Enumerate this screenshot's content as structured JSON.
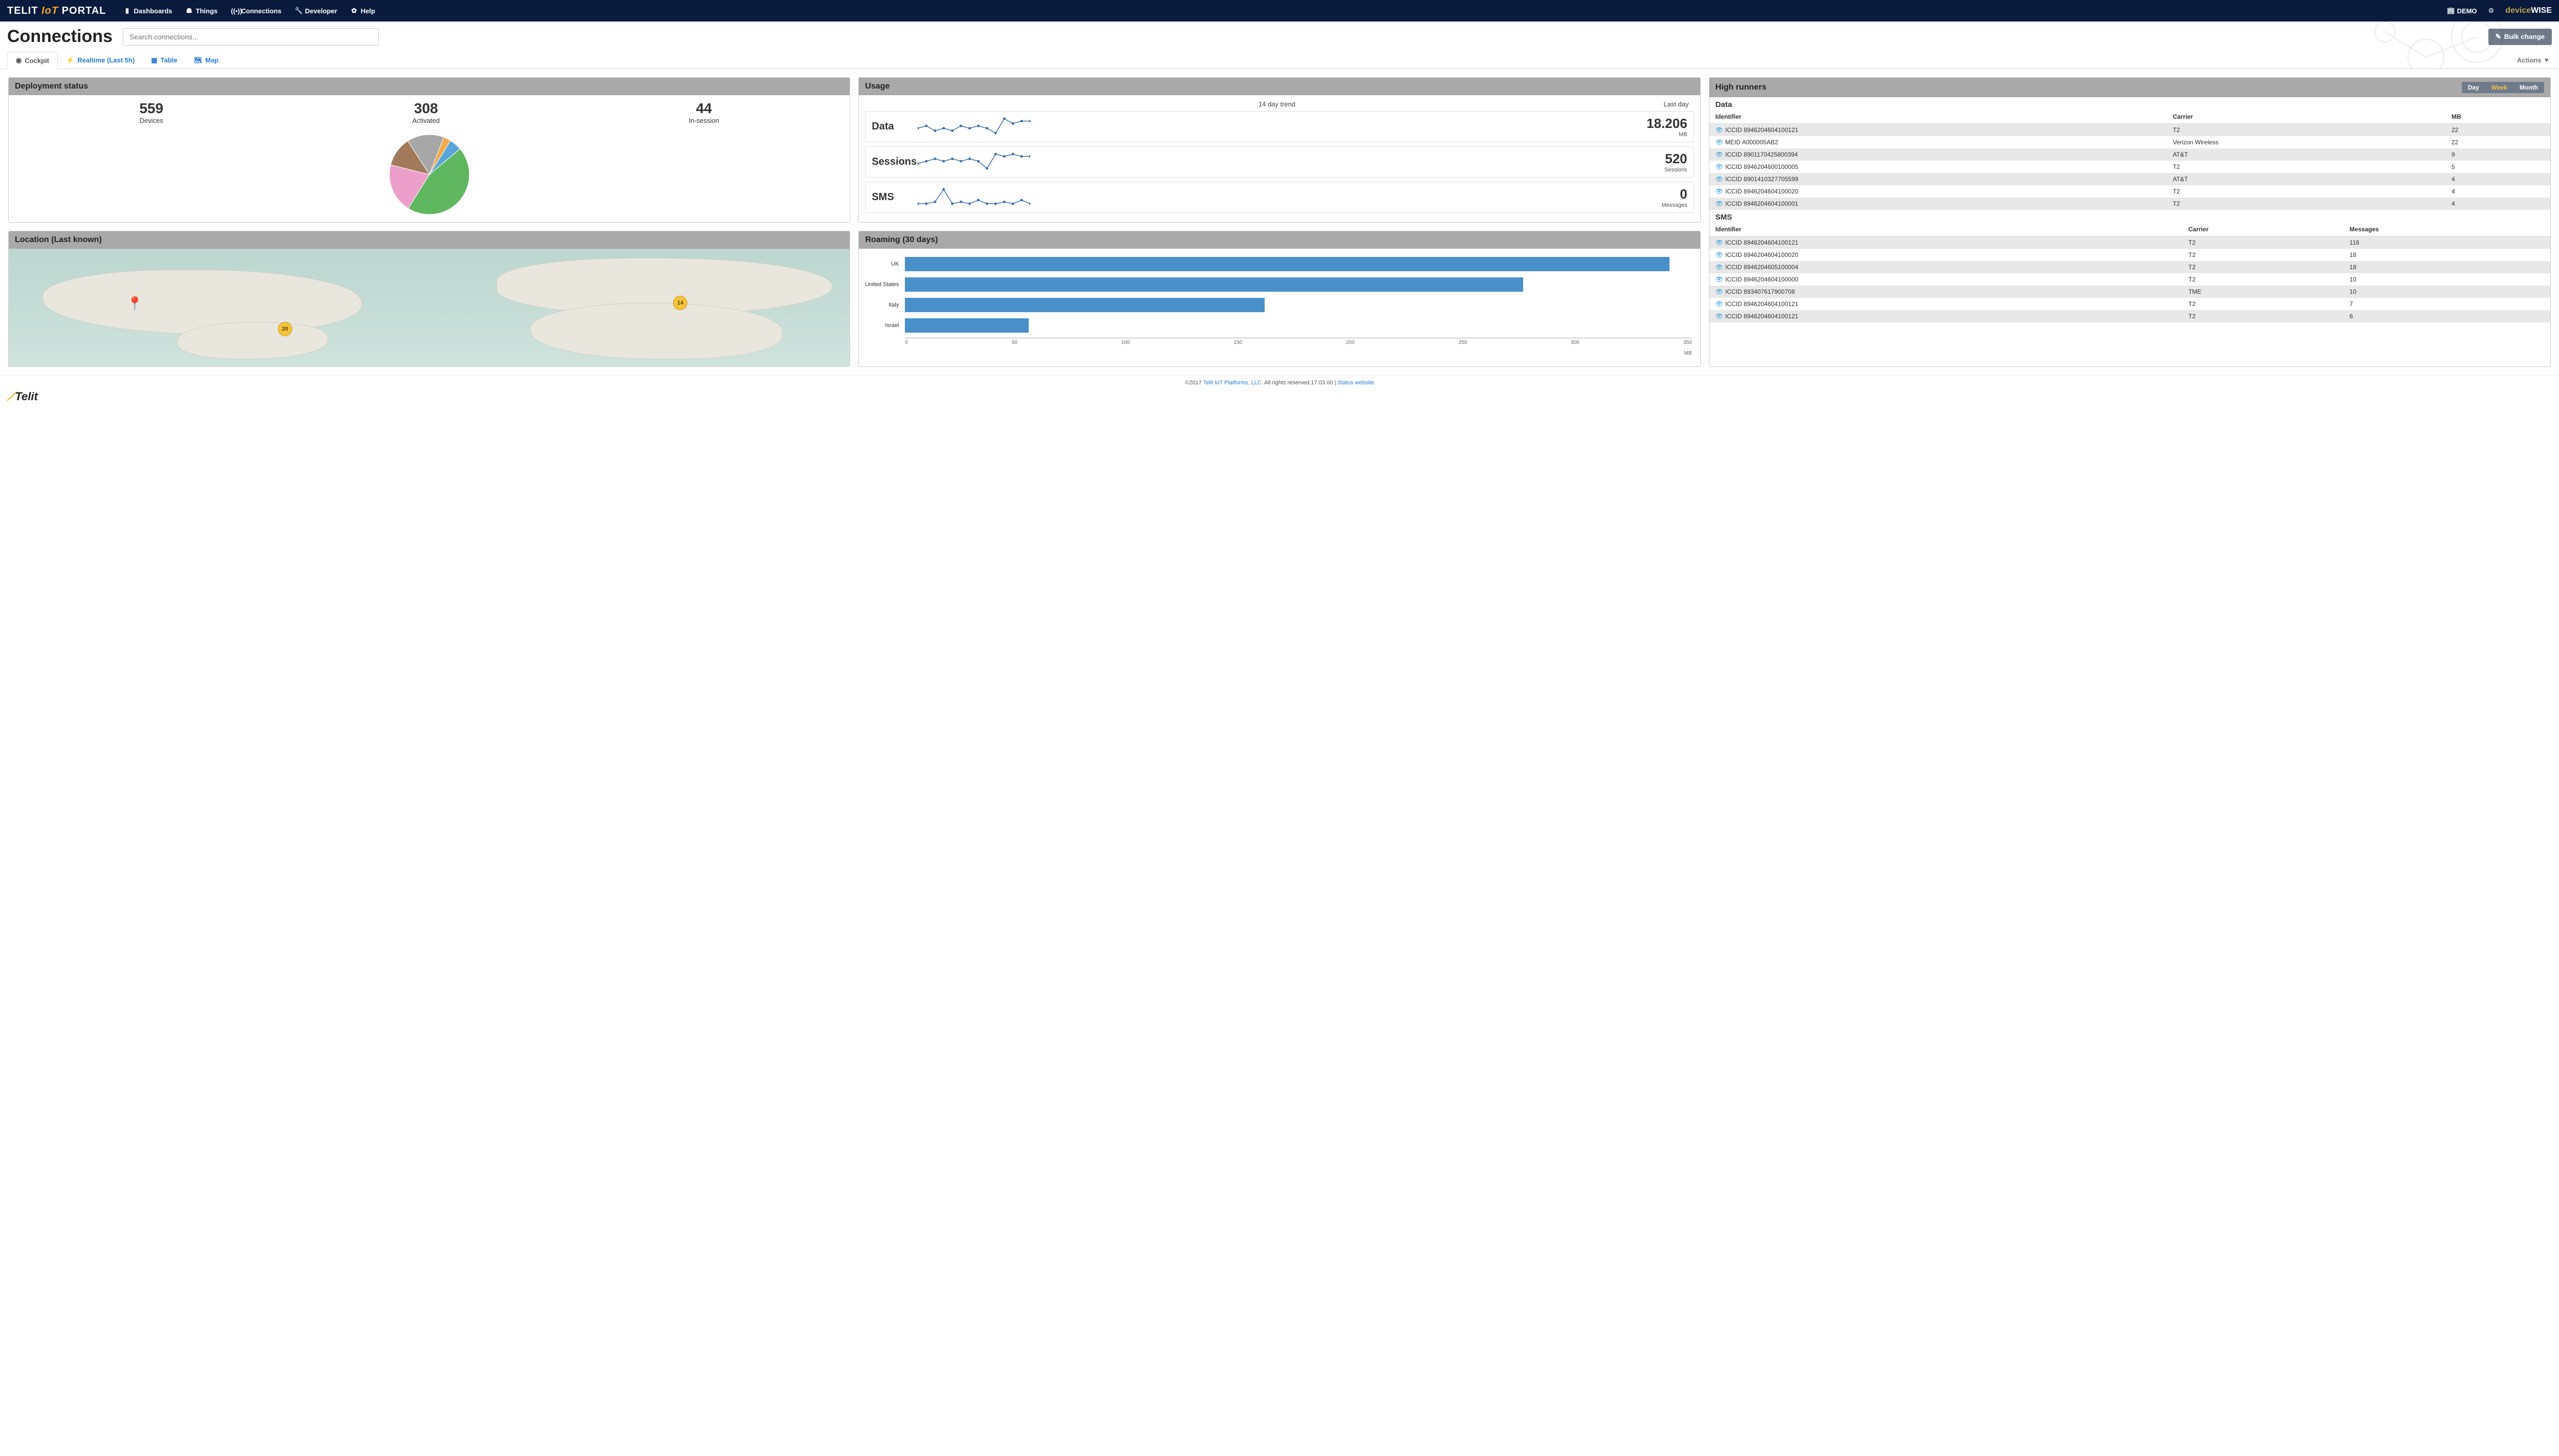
{
  "nav": {
    "brand1": "TELIT ",
    "brand2": "IoT",
    "brand3": " PORTAL",
    "items": [
      {
        "label": "Dashboards"
      },
      {
        "label": "Things"
      },
      {
        "label": "Connections"
      },
      {
        "label": "Developer"
      },
      {
        "label": "Help"
      }
    ],
    "demo": "DEMO",
    "dw1": "device",
    "dw2": "WISE"
  },
  "page": {
    "title": "Connections",
    "search_placeholder": "Search connections...",
    "bulk_label": "Bulk change",
    "actions_label": "Actions"
  },
  "tabs": [
    {
      "label": "Cockpit",
      "active": true
    },
    {
      "label": "Realtime (Last 5h)"
    },
    {
      "label": "Table"
    },
    {
      "label": "Map"
    }
  ],
  "deployment": {
    "title": "Deployment status",
    "stats": [
      {
        "num": "559",
        "label": "Devices"
      },
      {
        "num": "308",
        "label": "Activated"
      },
      {
        "num": "44",
        "label": "In-session"
      }
    ],
    "pie_slices": [
      {
        "color": "#5fb75f",
        "pct": 45
      },
      {
        "color": "#ec9fcb",
        "pct": 20
      },
      {
        "color": "#a07a5a",
        "pct": 12
      },
      {
        "color": "#a7a7a7",
        "pct": 15
      },
      {
        "color": "#f0a94a",
        "pct": 3
      },
      {
        "color": "#5aa6d8",
        "pct": 5
      }
    ]
  },
  "usage": {
    "title": "Usage",
    "col_trend": "14 day trend",
    "col_last": "Last day",
    "rows": [
      {
        "label": "Data",
        "value": "18.206",
        "unit": "MB",
        "spark": [
          14,
          15,
          13,
          14,
          13,
          15,
          14,
          15,
          14,
          12,
          18,
          16,
          17,
          17
        ]
      },
      {
        "label": "Sessions",
        "value": "520",
        "unit": "Sessions",
        "spark": [
          14,
          15,
          16,
          15,
          16,
          15,
          16,
          15,
          12,
          18,
          17,
          18,
          17,
          17
        ]
      },
      {
        "label": "SMS",
        "value": "0",
        "unit": "Messages",
        "spark": [
          2,
          2,
          3,
          10,
          2,
          3,
          2,
          4,
          2,
          2,
          3,
          2,
          4,
          2
        ]
      }
    ]
  },
  "highrunners": {
    "title": "High runners",
    "segments": [
      {
        "label": "Day"
      },
      {
        "label": "Week",
        "active": true
      },
      {
        "label": "Month"
      }
    ],
    "data_title": "Data",
    "data_cols": {
      "id": "Identifier",
      "carrier": "Carrier",
      "val": "MB"
    },
    "data_rows": [
      {
        "id": "ICCID 8946204604100121",
        "carrier": "T2",
        "val": "22"
      },
      {
        "id": "MEID A000005AB2",
        "carrier": "Verizon Wireless",
        "val": "22"
      },
      {
        "id": "ICCID 8901170425800394",
        "carrier": "AT&T",
        "val": "9"
      },
      {
        "id": "ICCID 8946204600100005",
        "carrier": "T2",
        "val": "5"
      },
      {
        "id": "ICCID 8901410327705599",
        "carrier": "AT&T",
        "val": "4"
      },
      {
        "id": "ICCID 8946204604100020",
        "carrier": "T2",
        "val": "4"
      },
      {
        "id": "ICCID 8946204604100001",
        "carrier": "T2",
        "val": "4"
      }
    ],
    "sms_title": "SMS",
    "sms_cols": {
      "id": "Identifier",
      "carrier": "Carrier",
      "val": "Messages"
    },
    "sms_rows": [
      {
        "id": "ICCID 8946204604100121",
        "carrier": "T2",
        "val": "116"
      },
      {
        "id": "ICCID 8946204604100020",
        "carrier": "T2",
        "val": "18"
      },
      {
        "id": "ICCID 8946204605100004",
        "carrier": "T2",
        "val": "18"
      },
      {
        "id": "ICCID 8946204604100000",
        "carrier": "T2",
        "val": "10"
      },
      {
        "id": "ICCID 893407617900708",
        "carrier": "TME",
        "val": "10"
      },
      {
        "id": "ICCID 8946204604100121",
        "carrier": "T2",
        "val": "7"
      },
      {
        "id": "ICCID 8946204604100121",
        "carrier": "T2",
        "val": "6"
      }
    ]
  },
  "location": {
    "title": "Location (Last known)",
    "pins": [
      {
        "label": "20",
        "left": 32,
        "top": 62,
        "type": "cluster"
      },
      {
        "label": "14",
        "left": 79,
        "top": 40,
        "type": "cluster"
      },
      {
        "label": "",
        "left": 14,
        "top": 40,
        "type": "marker"
      }
    ]
  },
  "roaming": {
    "title": "Roaming (30 days)",
    "unit": "MB",
    "xmax": 350,
    "ticks": [
      "0",
      "50",
      "100",
      "150",
      "200",
      "250",
      "300",
      "350"
    ],
    "bars": [
      {
        "label": "UK",
        "value": 340
      },
      {
        "label": "United States",
        "value": 275
      },
      {
        "label": "Italy",
        "value": 160
      },
      {
        "label": "Israel",
        "value": 55
      }
    ]
  },
  "footer": {
    "copyright": "©2017 ",
    "link1": "Telit IoT Platforms, LLC.",
    "mid": " All rights reserved.17.03.00 | ",
    "link2": "Status website",
    "logo": "Telit"
  },
  "chart_data": [
    {
      "type": "pie",
      "title": "Deployment status",
      "series": [
        {
          "name": "share",
          "values": [
            45,
            20,
            12,
            15,
            3,
            5
          ]
        }
      ],
      "categories": [
        "green",
        "pink",
        "brown",
        "grey",
        "orange",
        "blue"
      ]
    },
    {
      "type": "line",
      "title": "Usage 14 day trend",
      "series": [
        {
          "name": "Data (MB)",
          "values": [
            14,
            15,
            13,
            14,
            13,
            15,
            14,
            15,
            14,
            12,
            18,
            16,
            17,
            17
          ]
        },
        {
          "name": "Sessions",
          "values": [
            14,
            15,
            16,
            15,
            16,
            15,
            16,
            15,
            12,
            18,
            17,
            18,
            17,
            17
          ]
        },
        {
          "name": "SMS",
          "values": [
            2,
            2,
            3,
            10,
            2,
            3,
            2,
            4,
            2,
            2,
            3,
            2,
            4,
            2
          ]
        }
      ],
      "x": [
        1,
        2,
        3,
        4,
        5,
        6,
        7,
        8,
        9,
        10,
        11,
        12,
        13,
        14
      ]
    },
    {
      "type": "bar",
      "title": "Roaming (30 days)",
      "categories": [
        "UK",
        "United States",
        "Italy",
        "Israel"
      ],
      "values": [
        340,
        275,
        160,
        55
      ],
      "xlabel": "MB",
      "ylabel": "",
      "ylim": [
        0,
        350
      ]
    }
  ]
}
